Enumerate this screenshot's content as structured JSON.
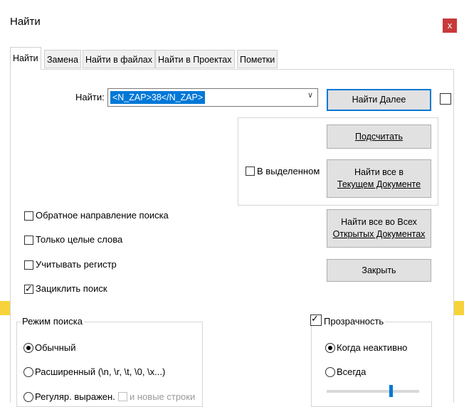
{
  "window": {
    "title": "Найти",
    "close_glyph": "x"
  },
  "tabs": [
    "Найти",
    "Замена",
    "Найти в файлах",
    "Найти в Проектах",
    "Пометки"
  ],
  "find": {
    "label": "Найти:",
    "value": "<N_ZAP>38</N_ZAP>",
    "dropdown_glyph": "∨"
  },
  "buttons": {
    "find_next": "Найти Далее",
    "count": "Подсчитать",
    "find_all_current_line1": "Найти все в",
    "find_all_current_line2": "Текущем Документе",
    "find_all_open_line1": "Найти все во Всех",
    "find_all_open_line2": "Открытых Документах",
    "close": "Закрыть"
  },
  "options": {
    "in_selection": "В выделенном",
    "backward": "Обратное направление поиска",
    "whole_words": "Только целые слова",
    "match_case": "Учитывать регистр",
    "wrap_around": "Зациклить поиск",
    "wrap_checked": true
  },
  "search_mode": {
    "title": "Режим поиска",
    "normal": "Обычный",
    "extended": "Расширенный (\\n, \\r, \\t, \\0, \\x...)",
    "regex": "Регуляр. выражен.",
    "newline": "и новые строки",
    "selected": "normal"
  },
  "transparency": {
    "title": "Прозрачность",
    "checked": true,
    "on_inactive": "Когда неактивно",
    "always": "Всегда",
    "selected": "on_inactive",
    "slider_level": 0.7
  },
  "colors": {
    "accent": "#0078d7",
    "close": "#c83a3a",
    "highlight_line": "#f6d33c"
  }
}
